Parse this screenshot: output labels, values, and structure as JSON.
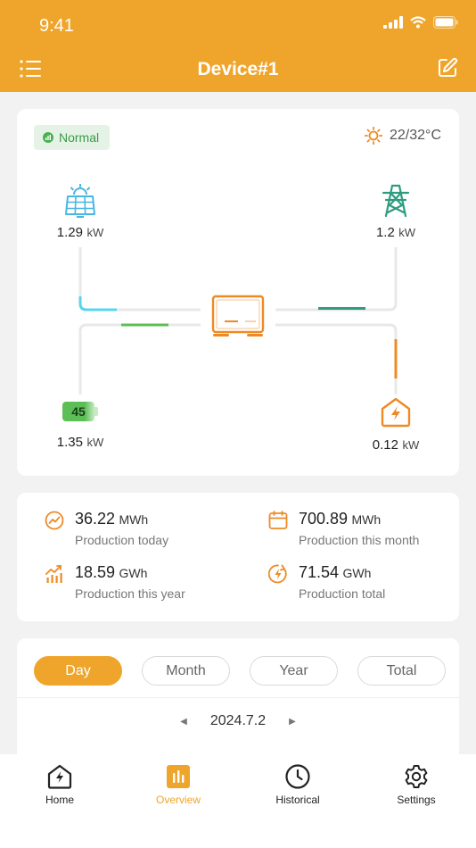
{
  "status_bar": {
    "time": "9:41"
  },
  "header": {
    "title": "Device#1",
    "menu_icon": "list-icon",
    "edit_icon": "edit-icon"
  },
  "flow": {
    "status_badge": "Normal",
    "weather": {
      "icon": "sun-icon",
      "temperature": "22/32°C"
    },
    "solar": {
      "value": "1.29",
      "unit": "kW",
      "icon": "solar-panel-icon",
      "color": "#4ab6e0"
    },
    "grid": {
      "value": "1.2",
      "unit": "kW",
      "icon": "power-tower-icon",
      "color": "#2e9c80"
    },
    "battery": {
      "level": "45",
      "value": "1.35",
      "unit": "kW",
      "icon": "battery-icon",
      "color": "#5cbf55"
    },
    "home": {
      "value": "0.12",
      "unit": "kW",
      "icon": "home-power-icon",
      "color": "#ee8a25"
    },
    "inverter": {
      "icon": "inverter-icon",
      "color": "#ee8a25"
    }
  },
  "production": {
    "today": {
      "value": "36.22",
      "unit": "MWh",
      "label": "Production today",
      "icon": "trend-icon"
    },
    "month": {
      "value": "700.89",
      "unit": "MWh",
      "label": "Production this month",
      "icon": "calendar-icon"
    },
    "year": {
      "value": "18.59",
      "unit": "GWh",
      "label": "Production this year",
      "icon": "bar-trend-icon"
    },
    "total": {
      "value": "71.54",
      "unit": "GWh",
      "label": "Production total",
      "icon": "bolt-circle-icon"
    }
  },
  "period_tabs": {
    "day": "Day",
    "month": "Month",
    "year": "Year",
    "total": "Total",
    "selected": "Day"
  },
  "date_selector": {
    "date": "2024.7.2"
  },
  "tabbar": {
    "home": "Home",
    "overview": "Overview",
    "historical": "Historical",
    "settings": "Settings",
    "active": "Overview",
    "accent": "#efa52b"
  }
}
